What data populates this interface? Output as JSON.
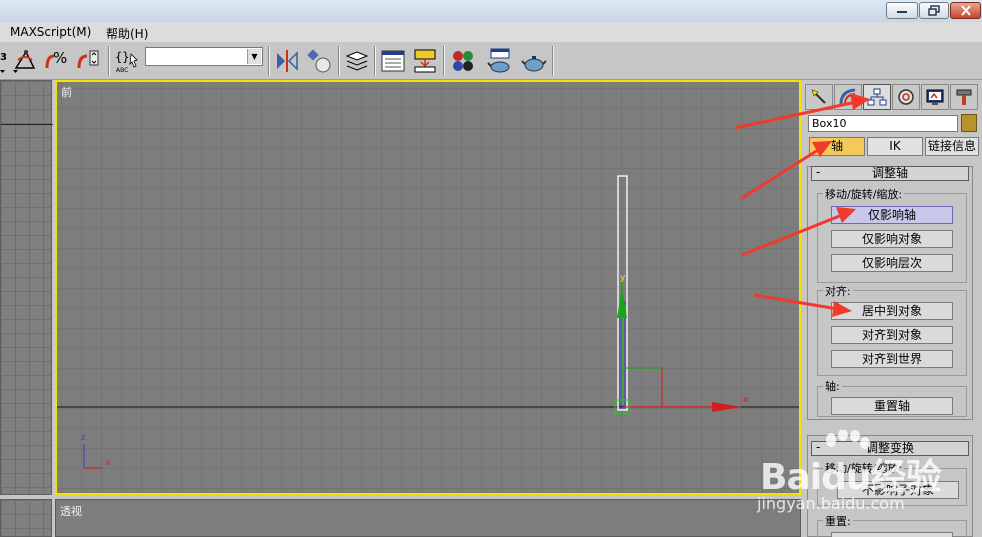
{
  "menu": {
    "items": [
      "MAXScript(M)",
      "帮助(H)"
    ]
  },
  "toolbar": {
    "named_selection_value": "",
    "icons": [
      "select-move-icon",
      "percent-snap-icon",
      "spinner-snap-icon",
      "named-selection-edit-icon",
      "mirror-icon",
      "align-icon",
      "layer-manager-icon",
      "curve-editor-icon",
      "schematic-view-icon",
      "material-editor-icon",
      "render-setup-icon",
      "quick-render-icon",
      "render-teapot-icon"
    ]
  },
  "viewports": {
    "front_label": "前",
    "perspective_label": "透视",
    "front_axes": {
      "gizmo_y_label": "y",
      "gizmo_x_label": "x",
      "corner_z_label": "z",
      "corner_x_label": "x"
    }
  },
  "command_panel": {
    "tabs": [
      "create-tab",
      "modify-tab",
      "hierarchy-tab",
      "motion-tab",
      "display-tab",
      "utilities-tab"
    ],
    "active_tab": "hierarchy-tab",
    "object_name": "Box10",
    "object_color": "#b8922a",
    "sub_tabs": {
      "pivot": "轴",
      "ik": "IK",
      "link_info": "链接信息"
    },
    "adjust_pivot": {
      "title": "调整轴",
      "collapse": "-",
      "move_group_label": "移动/旋转/缩放:",
      "affect_pivot_only": "仅影响轴",
      "affect_object_only": "仅影响对象",
      "affect_hierarchy_only": "仅影响层次",
      "align_group_label": "对齐:",
      "center_to_object": "居中到对象",
      "align_to_object": "对齐到对象",
      "align_to_world": "对齐到世界",
      "pivot_group_label": "轴:",
      "reset_pivot": "重置轴"
    },
    "adjust_transform": {
      "title": "调整变换",
      "move_group_label": "移动/旋转/缩放:",
      "dont_affect_children": "不影响子对象",
      "reset_group_label": "重置:"
    }
  },
  "watermark": {
    "brand": "Baidu经验",
    "site": "jingyan.baidu.com"
  },
  "colors": {
    "viewport_active_border": "#f2e400",
    "arrow_red": "#f03a2a",
    "axis_green": "#19a519",
    "axis_red": "#d41e1e"
  }
}
